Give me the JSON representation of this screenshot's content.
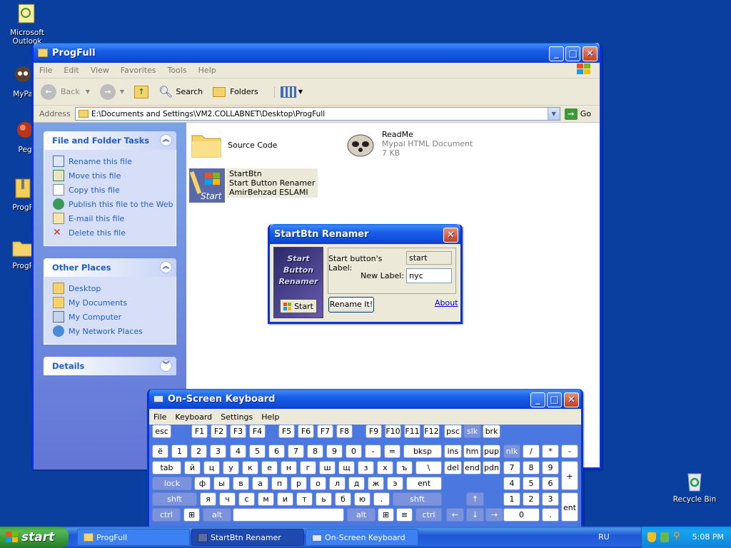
{
  "desktop": {
    "icons": [
      {
        "label": "Microsoft Outlook",
        "icon": "outlook-icon"
      },
      {
        "label": "MyPa",
        "icon": "mypal-icon"
      },
      {
        "label": "Peg",
        "icon": "peg-icon"
      },
      {
        "label": "ProgF",
        "icon": "zip-folder-icon"
      },
      {
        "label": "ProgF",
        "icon": "folder-icon"
      },
      {
        "label": "Recycle Bin",
        "icon": "recycle-bin-icon"
      }
    ]
  },
  "explorer": {
    "title": "ProgFull",
    "menu": [
      "File",
      "Edit",
      "View",
      "Favorites",
      "Tools",
      "Help"
    ],
    "toolbar": {
      "back": "Back",
      "search": "Search",
      "folders": "Folders"
    },
    "address": {
      "label": "Address",
      "value": "E:\\Documents and Settings\\VM2.COLLABNET\\Desktop\\ProgFull",
      "go": "Go"
    },
    "tasks": {
      "title": "File and Folder Tasks",
      "items": [
        "Rename this file",
        "Move this file",
        "Copy this file",
        "Publish this file to the Web",
        "E-mail this file",
        "Delete this file"
      ]
    },
    "places": {
      "title": "Other Places",
      "items": [
        "Desktop",
        "My Documents",
        "My Computer",
        "My Network Places"
      ]
    },
    "details": {
      "title": "Details"
    },
    "files": [
      {
        "name": "Source Code",
        "type": "",
        "size": ""
      },
      {
        "name": "ReadMe",
        "type": "Mypal HTML Document",
        "size": "7 KB"
      },
      {
        "name": "StartBtn",
        "type": "Start Button Renamer",
        "size": "AmirBehzad ESLAMI"
      }
    ]
  },
  "renamer": {
    "title": "StartBtn Renamer",
    "logo_text": "Start Button Renamer",
    "start_label": "Start",
    "current_label_caption": "Start button's Label:",
    "current_label_value": "start",
    "new_label_caption": "New Label:",
    "new_label_value": "пус",
    "rename_button": "Rename It!",
    "about_link": "About"
  },
  "osk": {
    "title": "On-Screen Keyboard",
    "menu": [
      "File",
      "Keyboard",
      "Settings",
      "Help"
    ]
  },
  "taskbar": {
    "start": "start",
    "items": [
      "ProgFull",
      "StartBtn Renamer",
      "On-Screen Keyboard"
    ],
    "lang": "RU",
    "clock": "5:08 PM"
  },
  "colors": {
    "desktop": "#0a3fa0",
    "titlebar": "#0b4ad8",
    "accent": "#215dc6"
  }
}
